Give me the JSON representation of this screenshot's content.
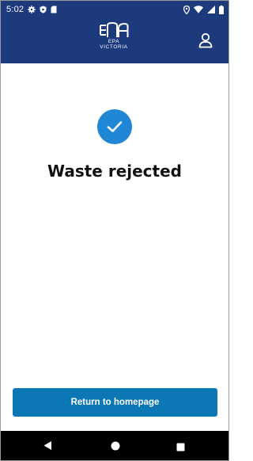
{
  "status_bar": {
    "time": "5:02",
    "left_icons": [
      "gear-icon",
      "shield-icon",
      "sd-card-icon"
    ],
    "right_icons": [
      "location-icon",
      "wifi-icon",
      "signal-icon",
      "battery-icon"
    ]
  },
  "header": {
    "logo_line1": "EPA",
    "logo_line2": "VICTORIA",
    "profile_icon": "person-icon"
  },
  "main": {
    "status_icon": "check-icon",
    "title": "Waste rejected",
    "button_label": "Return to homepage"
  },
  "nav_bar": {
    "icons": [
      "back-icon",
      "home-icon",
      "recents-icon"
    ]
  },
  "colors": {
    "header": "#1d3a7c",
    "check_circle": "#1f87d6",
    "button": "#0b78b5",
    "nav_bar": "#000000"
  }
}
